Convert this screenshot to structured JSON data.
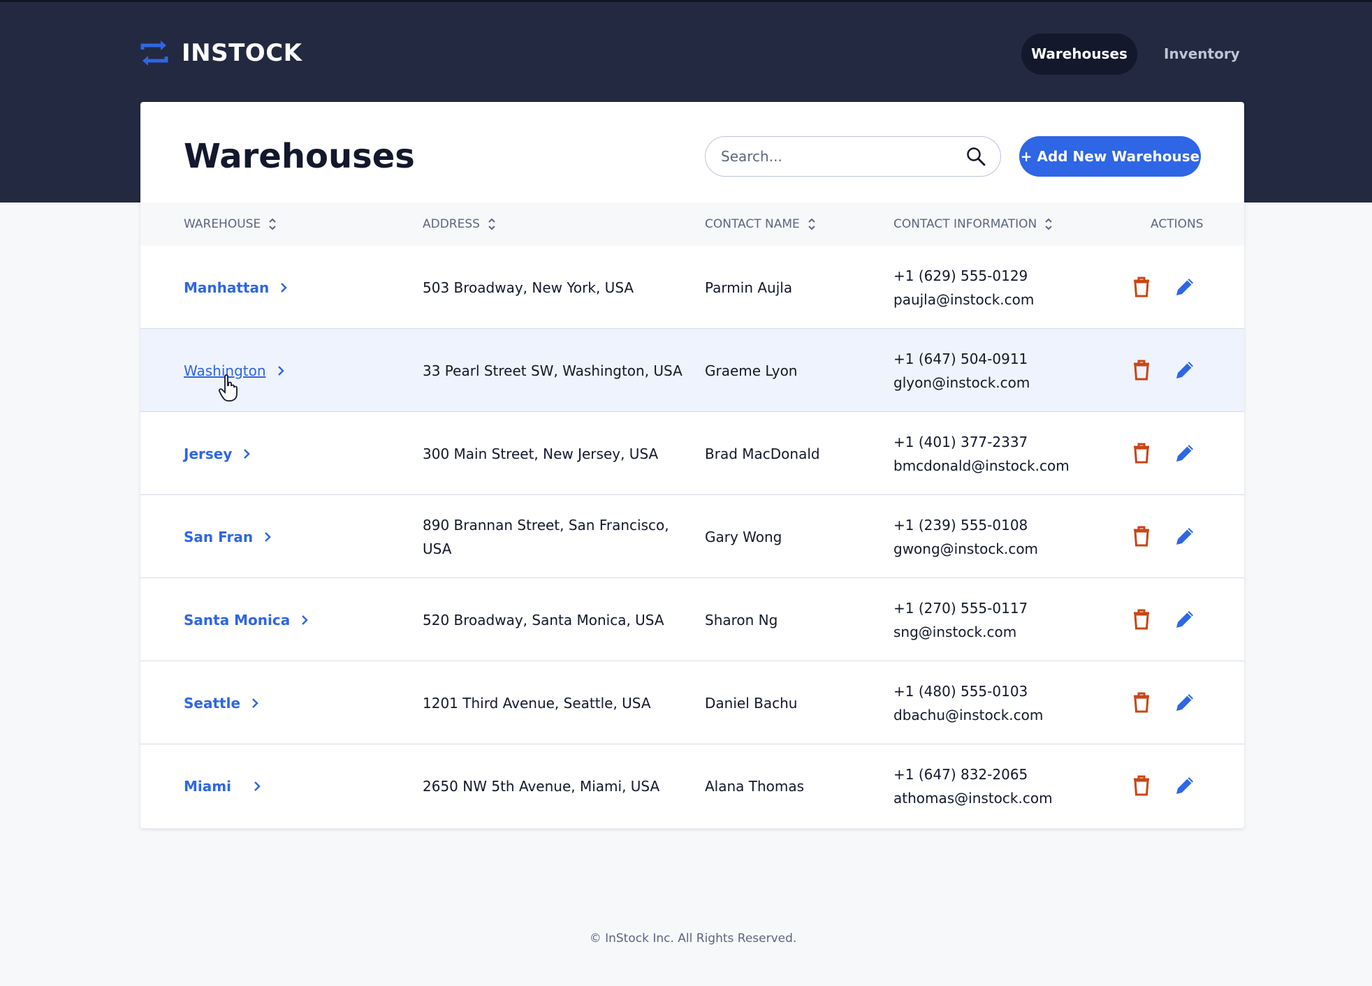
{
  "brand": {
    "name": "INSTOCK"
  },
  "nav": {
    "items": [
      {
        "label": "Warehouses",
        "active": true
      },
      {
        "label": "Inventory",
        "active": false
      }
    ]
  },
  "page": {
    "title": "Warehouses",
    "search_placeholder": "Search...",
    "add_button": "+ Add New Warehouse"
  },
  "table": {
    "columns": [
      "WAREHOUSE",
      "ADDRESS",
      "CONTACT NAME",
      "CONTACT INFORMATION",
      "ACTIONS"
    ],
    "rows": [
      {
        "warehouse": "Manhattan",
        "address": "503 Broadway, New York, USA",
        "contact": "Parmin Aujla",
        "phone": "+1 (629) 555-0129",
        "email": "paujla@instock.com"
      },
      {
        "warehouse": "Washington",
        "address": "33 Pearl Street SW, Washington, USA",
        "contact": "Graeme Lyon",
        "phone": "+1 (647) 504-0911",
        "email": "glyon@instock.com"
      },
      {
        "warehouse": "Jersey",
        "address": "300 Main Street, New Jersey, USA",
        "contact": "Brad MacDonald",
        "phone": "+1 (401) 377-2337",
        "email": "bmcdonald@instock.com"
      },
      {
        "warehouse": "San Fran",
        "address_line1": "890 Brannan Street, San Francisco,",
        "address_line2": "USA",
        "contact": "Gary Wong",
        "phone": "+1 (239) 555-0108",
        "email": "gwong@instock.com"
      },
      {
        "warehouse": "Santa Monica",
        "address": "520 Broadway, Santa Monica, USA",
        "contact": "Sharon Ng",
        "phone": "+1 (270) 555-0117",
        "email": "sng@instock.com"
      },
      {
        "warehouse": "Seattle",
        "address": "1201 Third Avenue, Seattle, USA",
        "contact": "Daniel Bachu",
        "phone": "+1 (480) 555-0103",
        "email": "dbachu@instock.com"
      },
      {
        "warehouse": "Miami",
        "address": "2650 NW 5th Avenue, Miami, USA",
        "contact": "Alana Thomas",
        "phone": "+1 (647) 832-2065",
        "email": "athomas@instock.com"
      }
    ]
  },
  "footer": {
    "text": "© InStock Inc. All Rights Reserved."
  },
  "colors": {
    "header_bg": "#232940",
    "accent": "#2e66e5",
    "delete": "#c94515",
    "muted": "#5c667e"
  },
  "icons": {
    "logo": "swap-arrows-icon",
    "search": "search-icon",
    "sort": "sort-icon",
    "chevron": "chevron-right-icon",
    "delete": "trash-icon",
    "edit": "pencil-icon"
  }
}
